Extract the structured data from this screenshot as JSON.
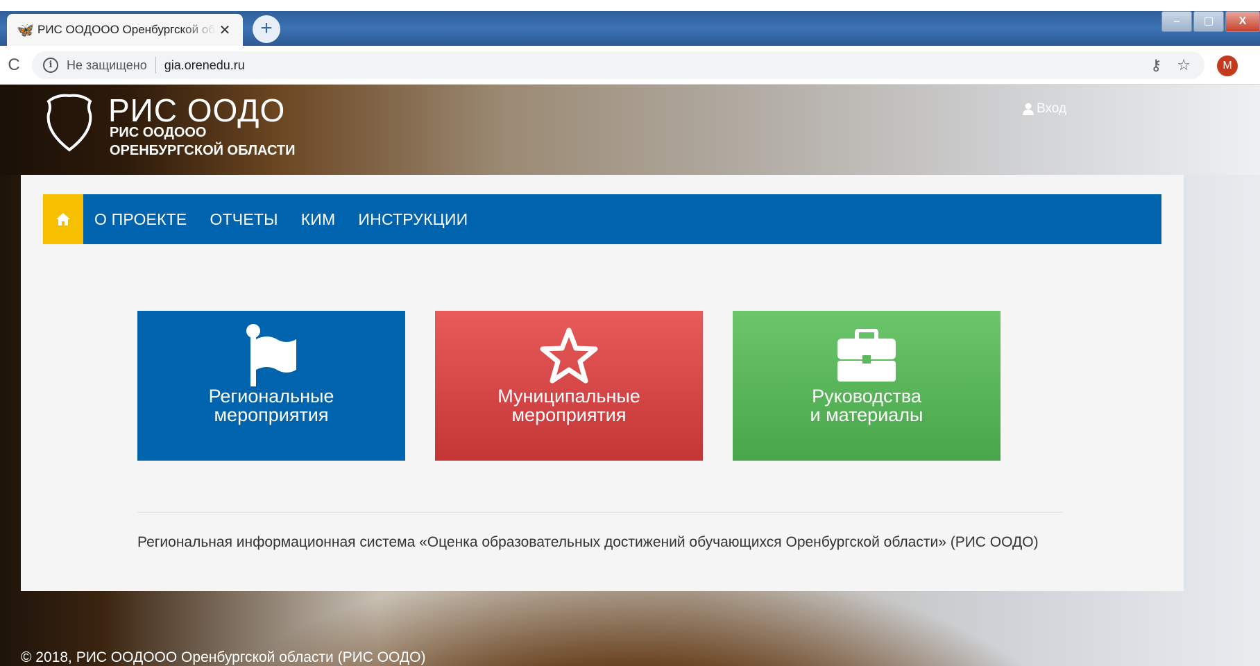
{
  "browser": {
    "tab_title": "РИС ООДООО Оренбургской области",
    "tab_icon": "🦋",
    "new_tab": "+",
    "close": "✕",
    "win_minimize": "–",
    "win_maximize": "▢",
    "win_close": "X",
    "reload": "C",
    "info": "i",
    "security_text": "Не защищено",
    "url": "gia.orenedu.ru",
    "key": "⚷",
    "star": "☆",
    "avatar_letter": "M",
    "menu": "⋮"
  },
  "header": {
    "title": "РИС ООДО",
    "subtitle_line1": "РИС ООДООО",
    "subtitle_line2": "ОРЕНБУРГСКОЙ ОБЛАСТИ",
    "login_label": "Вход"
  },
  "nav": {
    "items": [
      "О ПРОЕКТЕ",
      "ОТЧЕТЫ",
      "КИМ",
      "ИНСТРУКЦИИ"
    ]
  },
  "tiles": [
    {
      "line1": "Региональные",
      "line2": "мероприятия",
      "icon": "flag-icon",
      "color": "#0063ad"
    },
    {
      "line1": "Муниципальные",
      "line2": "мероприятия",
      "icon": "star-icon",
      "color": "#d94848"
    },
    {
      "line1": "Руководства",
      "line2": "и материалы",
      "icon": "briefcase-icon",
      "color": "#5cb85c"
    }
  ],
  "footer": {
    "description": "Региональная информационная система «Оценка образовательных достижений обучающихся Оренбургской области» (РИС ООДО)",
    "copyright": "© 2018, РИС ООДООО Оренбургской области (РИС ООДО)"
  },
  "colors": {
    "nav_bg": "#0063ad",
    "home_btn": "#f6c000"
  }
}
